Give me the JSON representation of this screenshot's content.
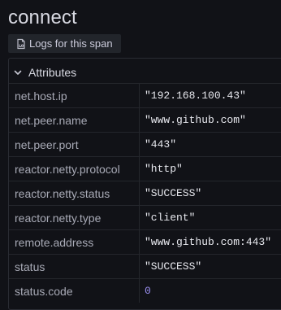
{
  "span": {
    "title": "connect",
    "logs_button": "Logs for this span",
    "logs_icon": "document-logs-icon"
  },
  "attributes": {
    "header": "Attributes",
    "chevron_icon": "chevron-down-icon",
    "rows": [
      {
        "key": "net.host.ip",
        "value": "\"192.168.100.43\"",
        "type": "string"
      },
      {
        "key": "net.peer.name",
        "value": "\"www.github.com\"",
        "type": "string"
      },
      {
        "key": "net.peer.port",
        "value": "\"443\"",
        "type": "string"
      },
      {
        "key": "reactor.netty.protocol",
        "value": "\"http\"",
        "type": "string"
      },
      {
        "key": "reactor.netty.status",
        "value": "\"SUCCESS\"",
        "type": "string"
      },
      {
        "key": "reactor.netty.type",
        "value": "\"client\"",
        "type": "string"
      },
      {
        "key": "remote.address",
        "value": "\"www.github.com:443\"",
        "type": "string"
      },
      {
        "key": "status",
        "value": "\"SUCCESS\"",
        "type": "string"
      },
      {
        "key": "status.code",
        "value": "0",
        "type": "number"
      }
    ]
  },
  "colors": {
    "background": "#111217",
    "key_text": "#a8aab6",
    "string_value": "#e7e8ee",
    "number_value": "#9a8ff0"
  }
}
